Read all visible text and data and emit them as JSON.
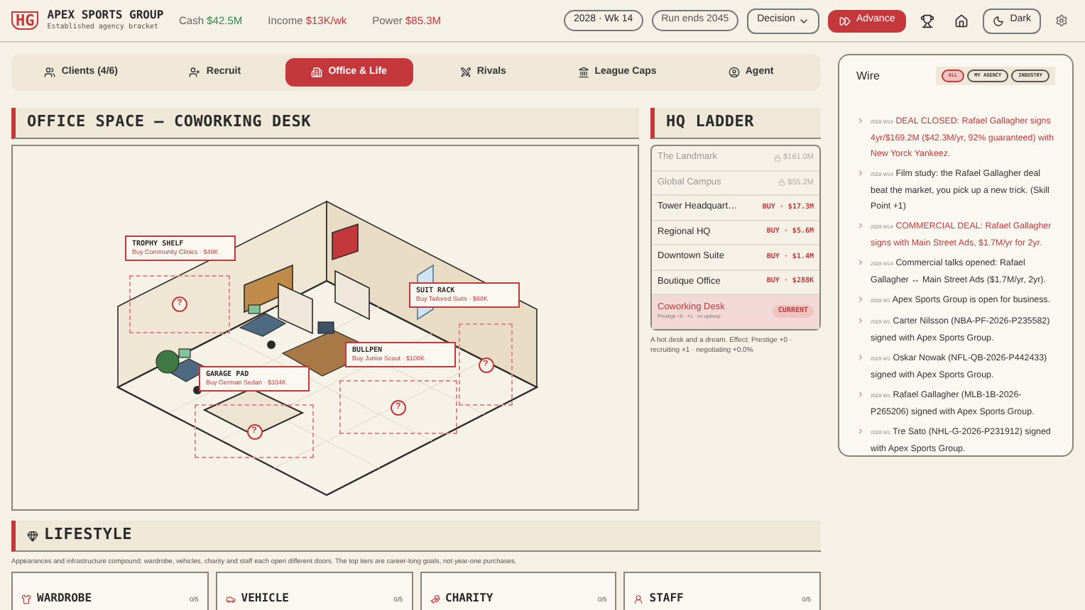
{
  "header": {
    "logo": "HG",
    "title": "APEX SPORTS GROUP",
    "subtitle": "Established agency bracket",
    "stats": [
      {
        "label": "Cash",
        "value": "$42.5M",
        "color": "#2f8a4a"
      },
      {
        "label": "Income",
        "value": "$13K/wk",
        "color": "#c4383b"
      },
      {
        "label": "Power",
        "value": "$85.3M",
        "color": "#c4383b"
      }
    ],
    "date": "2028 · Wk 14",
    "run_end": "Run ends 2045",
    "decision": "Decision",
    "advance": "Advance",
    "theme": "Dark"
  },
  "tabs": [
    {
      "label": "Clients (4/6)",
      "selected": false
    },
    {
      "label": "Recruit",
      "selected": false
    },
    {
      "label": "Office & Life",
      "selected": true
    },
    {
      "label": "Rivals",
      "selected": false
    },
    {
      "label": "League Caps",
      "selected": false
    },
    {
      "label": "Agent",
      "selected": false
    }
  ],
  "office": {
    "title": "OFFICE SPACE — COWORKING DESK",
    "labels": [
      {
        "title": "TROPHY SHELF",
        "action": "Buy Community Clinics · $48K"
      },
      {
        "title": "SUIT RACK",
        "action": "Buy Tailored Suits · $68K"
      },
      {
        "title": "BULLPEN",
        "action": "Buy Junior Scout · $108K"
      },
      {
        "title": "GARAGE PAD",
        "action": "Buy German Sedan · $334K"
      }
    ],
    "hotspots": [
      {
        "mark": "?"
      },
      {
        "mark": "?"
      },
      {
        "mark": "?"
      },
      {
        "mark": "?"
      }
    ]
  },
  "hq_ladder": {
    "title": "HQ LADDER",
    "rows": [
      {
        "name": "The Landmark",
        "kind": "locked",
        "price": "$161.0M"
      },
      {
        "name": "Global Campus",
        "kind": "locked",
        "price": "$55.2M"
      },
      {
        "name": "Tower Headquart…",
        "kind": "buy",
        "price": "BUY · $17.3M"
      },
      {
        "name": "Regional HQ",
        "kind": "buy",
        "price": "BUY · $5.6M"
      },
      {
        "name": "Downtown Suite",
        "kind": "buy",
        "price": "BUY · $1.4M"
      },
      {
        "name": "Boutique Office",
        "kind": "buy",
        "price": "BUY · $288K"
      },
      {
        "name": "Coworking Desk",
        "kind": "current",
        "price": "CURRENT",
        "detail": "Prestige +0 · ×1 · no upkeep"
      }
    ],
    "description": "A hot desk and a dream. Effect: Prestige +0 · recruiting ×1 · negotiating +0.0%"
  },
  "wire": {
    "title": "Wire",
    "filters": [
      {
        "label": "ALL",
        "selected": true
      },
      {
        "label": "MY AGENCY",
        "selected": false
      },
      {
        "label": "INDUSTRY",
        "selected": false
      }
    ],
    "items": [
      {
        "date": "2028 W14",
        "kind": "deal",
        "text": "DEAL CLOSED: Rafael Gallagher signs 4yr/$169.2M ($42.3M/yr, 92% guaranteed) with New Yorck Yankeez."
      },
      {
        "date": "2028 W14",
        "kind": "news",
        "text": "Film study: the Rafael Gallagher deal beat the market, you pick up a new trick. (Skill Point +1)"
      },
      {
        "date": "2028 W14",
        "kind": "deal",
        "text": "COMMERCIAL DEAL: Rafael Gallagher signs with Main Street Ads, $1.7M/yr for 2yr."
      },
      {
        "date": "2028 W14",
        "kind": "news",
        "text": "Commercial talks opened: Rafael Gallagher ↔ Main Street Ads ($1.7M/yr, 2yr)."
      },
      {
        "date": "2028 W1",
        "kind": "news",
        "text": "Apex Sports Group is open for business."
      },
      {
        "date": "2028 W1",
        "kind": "news",
        "text": "Carter Nilsson (NBA-PF-2026-P235582) signed with Apex Sports Group."
      },
      {
        "date": "2028 W1",
        "kind": "news",
        "text": "Oskar Nowak (NFL-QB-2026-P442433) signed with Apex Sports Group."
      },
      {
        "date": "2028 W1",
        "kind": "news",
        "text": "Rafael Gallagher (MLB-1B-2026-P265206) signed with Apex Sports Group."
      },
      {
        "date": "2028 W1",
        "kind": "news",
        "text": "Tre Sato (NHL-G-2026-P231912) signed with Apex Sports Group."
      }
    ]
  },
  "lifestyle": {
    "title": "LIFESTYLE",
    "description": "Appearances and infrastructure compound; wardrobe, vehicles, charity and staff each open different doors. The top tiers are career-long goals, not year-one purchases.",
    "cards": [
      {
        "title": "WARDROBE",
        "count": "0/5"
      },
      {
        "title": "VEHICLE",
        "count": "0/5"
      },
      {
        "title": "CHARITY",
        "count": "0/5"
      },
      {
        "title": "STAFF",
        "count": "0/5"
      }
    ]
  }
}
